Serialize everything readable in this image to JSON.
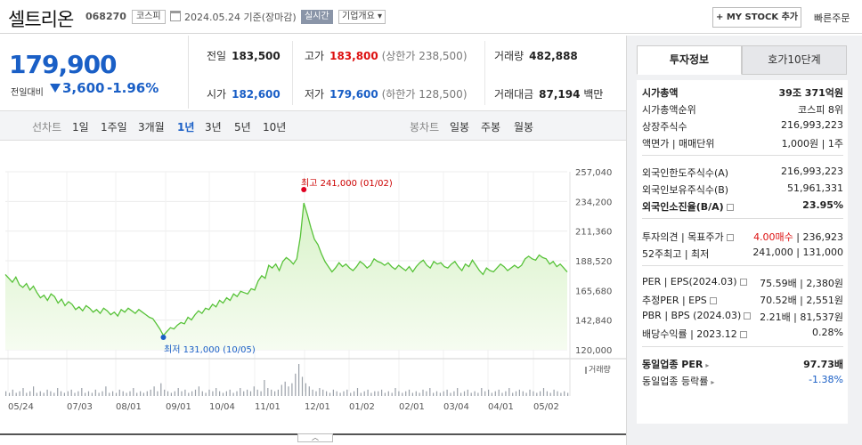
{
  "header": {
    "stock_name": "셀트리온",
    "stock_code": "068270",
    "market": "코스피",
    "date": "2024.05.24  기준(장마감)",
    "realtime_label": "실시간",
    "corp_overview": "기업개요 ▾",
    "my_stock_label": "+ MY STOCK 추가",
    "quick_order": "빠른주문"
  },
  "quote": {
    "price": "179,900",
    "prev_label": "전일대비",
    "change": "3,600",
    "change_pct": "-1.96%",
    "direction": "down"
  },
  "stats": {
    "prev_close": {
      "label": "전일",
      "value": "183,500"
    },
    "open": {
      "label": "시가",
      "value": "182,600"
    },
    "high": {
      "label": "고가",
      "value": "183,800",
      "sub": "(상한가 238,500)"
    },
    "low": {
      "label": "저가",
      "value": "179,600",
      "sub": "(하한가 128,500)"
    },
    "volume": {
      "label": "거래량",
      "value": "482,888"
    },
    "amount": {
      "label": "거래대금",
      "value": "87,194",
      "unit": "백만"
    }
  },
  "period_bar": {
    "line_label": "선차트",
    "periods": [
      "1일",
      "1주일",
      "3개월",
      "1년",
      "3년",
      "5년",
      "10년"
    ],
    "selected_period": "1년",
    "candle_label": "봉차트",
    "candles": [
      "일봉",
      "주봉",
      "월봉"
    ]
  },
  "chart_data": {
    "type": "area",
    "title": "",
    "ylim": [
      120000,
      257040
    ],
    "y_ticks": [
      "257,040",
      "234,200",
      "211,360",
      "188,520",
      "165,680",
      "142,840",
      "120,000"
    ],
    "x_ticks": [
      "05/24",
      "07/03",
      "08/01",
      "09/01",
      "10/04",
      "11/01",
      "12/01",
      "01/02",
      "02/01",
      "03/04",
      "04/01",
      "05/02"
    ],
    "high_annotation": "최고 241,000 (01/02)",
    "low_annotation": "최저 131,000 (10/05)",
    "volume_label": "거래량",
    "price_series": [
      178000,
      175000,
      172000,
      176000,
      170000,
      168000,
      171000,
      166000,
      169000,
      164000,
      160000,
      162000,
      158000,
      163000,
      161000,
      156000,
      159000,
      154000,
      157000,
      155000,
      151000,
      153000,
      150000,
      154000,
      152000,
      149000,
      151000,
      148000,
      152000,
      150000,
      147000,
      149000,
      146000,
      151000,
      149000,
      152000,
      150000,
      148000,
      151000,
      149000,
      147000,
      145000,
      144000,
      140000,
      136000,
      131000,
      134000,
      137000,
      136000,
      139000,
      141000,
      140000,
      145000,
      143000,
      147000,
      150000,
      148000,
      152000,
      151000,
      155000,
      153000,
      158000,
      156000,
      160000,
      158000,
      163000,
      161000,
      165000,
      164000,
      163000,
      167000,
      166000,
      173000,
      177000,
      175000,
      185000,
      183000,
      186000,
      181000,
      188000,
      191000,
      189000,
      186000,
      190000,
      207000,
      233000,
      224000,
      214000,
      205000,
      201000,
      194000,
      188000,
      184000,
      180000,
      183000,
      187000,
      184000,
      186000,
      183000,
      181000,
      184000,
      188000,
      186000,
      183000,
      185000,
      190000,
      188000,
      187000,
      185000,
      187000,
      184000,
      182000,
      185000,
      183000,
      181000,
      184000,
      180000,
      184000,
      187000,
      189000,
      185000,
      183000,
      188000,
      186000,
      187000,
      184000,
      183000,
      186000,
      188000,
      184000,
      181000,
      186000,
      184000,
      189000,
      185000,
      181000,
      178000,
      183000,
      181000,
      180000,
      183000,
      186000,
      184000,
      181000,
      183000,
      185000,
      183000,
      185000,
      190000,
      192000,
      190000,
      189000,
      193000,
      191000,
      190000,
      186000,
      188000,
      184000,
      186000,
      183000,
      179900
    ],
    "volume_series": [
      3,
      2,
      4,
      2,
      3,
      5,
      2,
      3,
      6,
      2,
      3,
      2,
      4,
      3,
      2,
      5,
      3,
      2,
      3,
      4,
      2,
      3,
      5,
      2,
      3,
      2,
      4,
      2,
      3,
      6,
      2,
      3,
      2,
      4,
      3,
      2,
      3,
      5,
      2,
      3,
      2,
      3,
      4,
      6,
      3,
      8,
      4,
      3,
      2,
      3,
      5,
      3,
      4,
      2,
      3,
      4,
      6,
      3,
      2,
      4,
      3,
      5,
      3,
      2,
      3,
      4,
      2,
      3,
      5,
      3,
      4,
      3,
      6,
      4,
      3,
      10,
      5,
      4,
      3,
      4,
      7,
      9,
      6,
      8,
      14,
      20,
      12,
      8,
      6,
      4,
      3,
      5,
      4,
      3,
      2,
      4,
      3,
      2,
      3,
      4,
      2,
      3,
      5,
      2,
      3,
      4,
      2,
      3,
      3,
      4,
      2,
      3,
      2,
      5,
      3,
      2,
      3,
      4,
      2,
      3,
      2,
      4,
      3,
      5,
      2,
      3,
      2,
      3,
      4,
      2,
      3,
      5,
      2,
      3,
      4,
      2,
      3,
      2,
      5,
      3,
      4,
      2,
      3,
      4,
      2,
      3,
      5,
      2,
      3,
      4,
      3,
      2,
      4,
      3,
      2,
      3,
      5,
      3,
      2,
      4,
      3,
      2,
      3,
      2
    ],
    "colors": {
      "line": "#57c238",
      "fill_top": "#d8f2c8",
      "fill_bottom": "#f6fcf1",
      "high": "#e00020",
      "low": "#1a5fc6"
    }
  },
  "side_panel": {
    "tabs": [
      "투자정보",
      "호가10단계"
    ],
    "active_tab": "투자정보",
    "market_cap": {
      "label": "시가총액",
      "value": "39조 371억원"
    },
    "market_cap_rank": {
      "label": "시가총액순위",
      "value": "코스피 8위"
    },
    "listed_shares": {
      "label": "상장주식수",
      "value": "216,993,223"
    },
    "face_value": {
      "label": "액면가 | 매매단위",
      "value": "1,000원 | 1주"
    },
    "foreign_limit": {
      "label": "외국인한도주식수(A)",
      "value": "216,993,223"
    },
    "foreign_holding": {
      "label": "외국인보유주식수(B)",
      "value": "51,961,331"
    },
    "foreign_rate": {
      "label": "외국인소진율(B/A)",
      "value": "23.95%"
    },
    "opinion": {
      "label": "투자의견 | 목표주가",
      "value_rating": "4.00매수",
      "value_target": "| 236,923"
    },
    "range_52w": {
      "label": "52주최고 | 최저",
      "value": "241,000 | 131,000"
    },
    "per_eps": {
      "label": "PER | EPS(2024.03)",
      "value": "75.59배 | 2,380원"
    },
    "est_per_eps": {
      "label": "추정PER | EPS",
      "value": "70.52배 | 2,551원"
    },
    "pbr_bps": {
      "label": "PBR | BPS (2024.03)",
      "value": "2.21배 | 81,537원"
    },
    "dividend": {
      "label": "배당수익률 | 2023.12",
      "value": "0.28%"
    },
    "sector_per": {
      "label": "동일업종 PER",
      "value": "97.73배"
    },
    "sector_change": {
      "label": "동일업종 등락률",
      "value": "-1.38%"
    }
  }
}
